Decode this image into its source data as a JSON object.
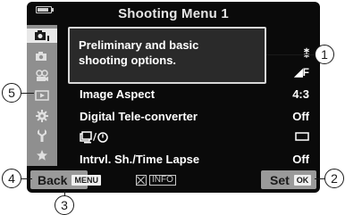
{
  "header": {
    "title": "Shooting Menu 1"
  },
  "sidebar": {
    "items": [
      {
        "icon": "camera-1-tab-icon",
        "selected": true
      },
      {
        "icon": "camera-2-tab-icon",
        "selected": false
      },
      {
        "icon": "video-tab-icon",
        "selected": false
      },
      {
        "icon": "playback-tab-icon",
        "selected": false
      },
      {
        "icon": "custom-gear-tab-icon",
        "selected": false
      },
      {
        "icon": "setup-wrench-tab-icon",
        "selected": false
      },
      {
        "icon": "mymenu-star-tab-icon",
        "selected": false
      }
    ]
  },
  "tooltip": {
    "line1": "Preliminary and basic",
    "line2": "shooting options."
  },
  "menu": {
    "rows": [
      {
        "label": "",
        "value": ""
      },
      {
        "label": "",
        "value": ""
      },
      {
        "label": "",
        "value": ""
      },
      {
        "label": "Image Aspect",
        "value": "4:3"
      },
      {
        "label": "Digital Tele-converter",
        "value": "Off"
      },
      {
        "label": "",
        "value": ""
      },
      {
        "label": "Intrvl. Sh./Time Lapse",
        "value": "Off"
      }
    ]
  },
  "bottom": {
    "back_label": "Back",
    "back_key": "MENU",
    "info_label": "INFO",
    "set_label": "Set",
    "set_key": "OK"
  },
  "callouts": {
    "c1": "1",
    "c2": "2",
    "c3": "3",
    "c4": "4",
    "c5": "5"
  }
}
